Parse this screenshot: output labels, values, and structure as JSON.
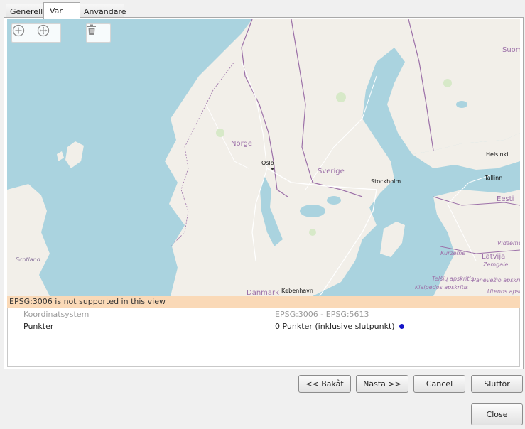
{
  "tabs": [
    {
      "label": "Generellt"
    },
    {
      "label": "Var"
    },
    {
      "label": "Användare"
    }
  ],
  "map": {
    "labels": {
      "norge": "Norge",
      "sverige": "Sverige",
      "suomi": "Suom",
      "eesti": "Eesti",
      "latvija": "Latvija",
      "danmark": "Danmark",
      "oslo": "Oslo",
      "stockholm": "Stockholm",
      "helsinki": "Helsinki",
      "tallinn": "Tallinn",
      "kobenhavn": "København",
      "scotland": "Scotland",
      "kurzeme": "Kurzeme",
      "zemgale": "Zemgale",
      "vidzeme": "Vidzeme",
      "telsiu": "Telšių apskritis",
      "panevezio": "Panevėžio apskritis",
      "klaipedos": "Klaipėdos apskritis",
      "utenos": "Utenos apskr"
    },
    "colors": {
      "water": "#aad3df",
      "land": "#f2efe9",
      "border": "#9c70a8",
      "road": "#ffffff"
    }
  },
  "toolbar": {
    "zoom_in_icon": "plus-circle-icon",
    "pan_icon": "move-arrows-icon",
    "delete_icon": "trash-icon"
  },
  "status": {
    "message": "EPSG:3006 is not supported in this view",
    "color": "#fad9b7"
  },
  "properties": [
    {
      "key": "Koordinatsystem",
      "value": "EPSG:3006 - EPSG:5613"
    },
    {
      "key": "Punkter",
      "value": "0 Punkter  (inklusive slutpunkt)"
    }
  ],
  "buttons": {
    "back": "<< Bakåt",
    "next": "Nästa >>",
    "cancel": "Cancel",
    "finish": "Slutför",
    "close": "Close"
  }
}
